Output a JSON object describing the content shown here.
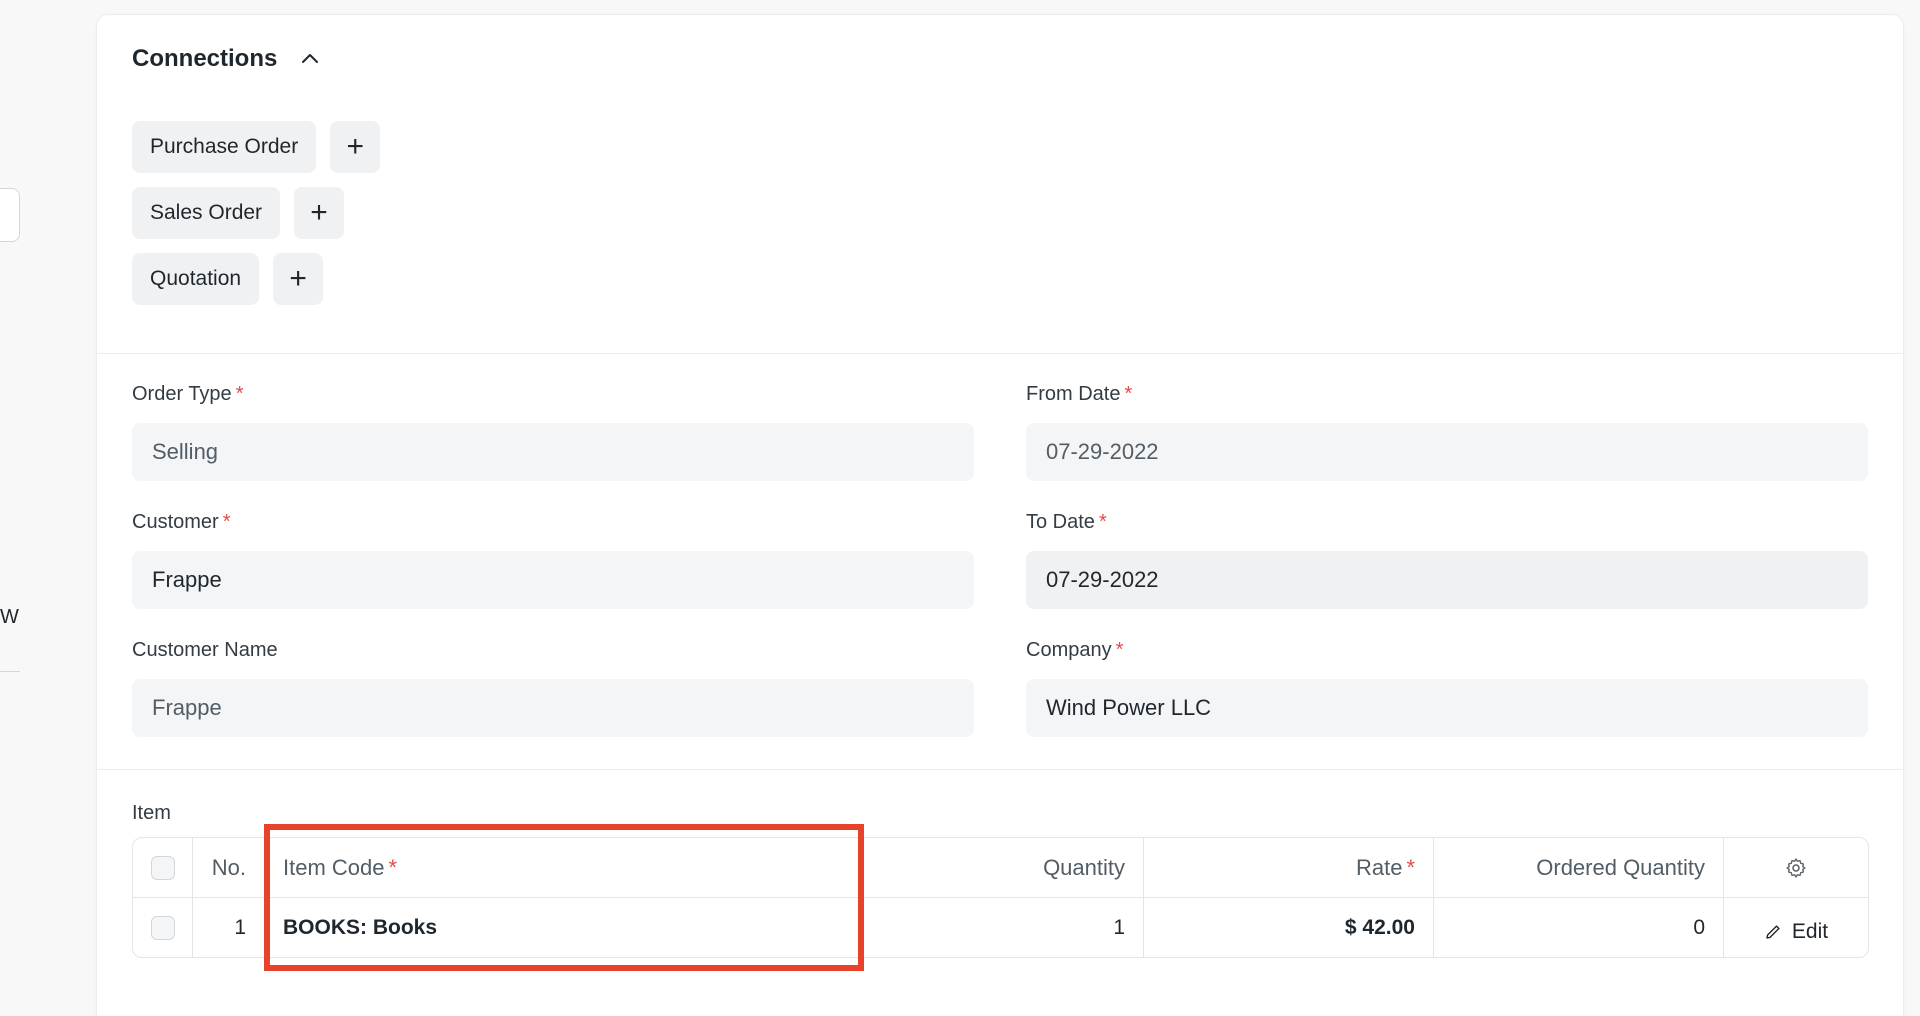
{
  "sidebar": {
    "fragment_text": "W"
  },
  "connections": {
    "title": "Connections",
    "items": [
      {
        "label": "Purchase Order",
        "add_label": "+"
      },
      {
        "label": "Sales Order",
        "add_label": "+"
      },
      {
        "label": "Quotation",
        "add_label": "+"
      }
    ]
  },
  "form": {
    "order_type": {
      "label": "Order Type",
      "required": "*",
      "value": "Selling"
    },
    "from_date": {
      "label": "From Date",
      "required": "*",
      "value": "07-29-2022"
    },
    "customer": {
      "label": "Customer",
      "required": "*",
      "value": "Frappe"
    },
    "to_date": {
      "label": "To Date",
      "required": "*",
      "value": "07-29-2022"
    },
    "customer_name": {
      "label": "Customer Name",
      "value": "Frappe"
    },
    "company": {
      "label": "Company",
      "required": "*",
      "value": "Wind Power LLC"
    }
  },
  "items_table": {
    "label": "Item",
    "headers": {
      "no": "No.",
      "item_code": "Item Code",
      "item_code_required": "*",
      "quantity": "Quantity",
      "rate": "Rate",
      "rate_required": "*",
      "ordered_quantity": "Ordered Quantity"
    },
    "rows": [
      {
        "no": "1",
        "item_code": "BOOKS: Books",
        "quantity": "1",
        "rate": "$ 42.00",
        "ordered_quantity": "0",
        "action": "Edit"
      }
    ]
  },
  "colors": {
    "highlight": "#e8412c",
    "required": "#e24c4c"
  }
}
